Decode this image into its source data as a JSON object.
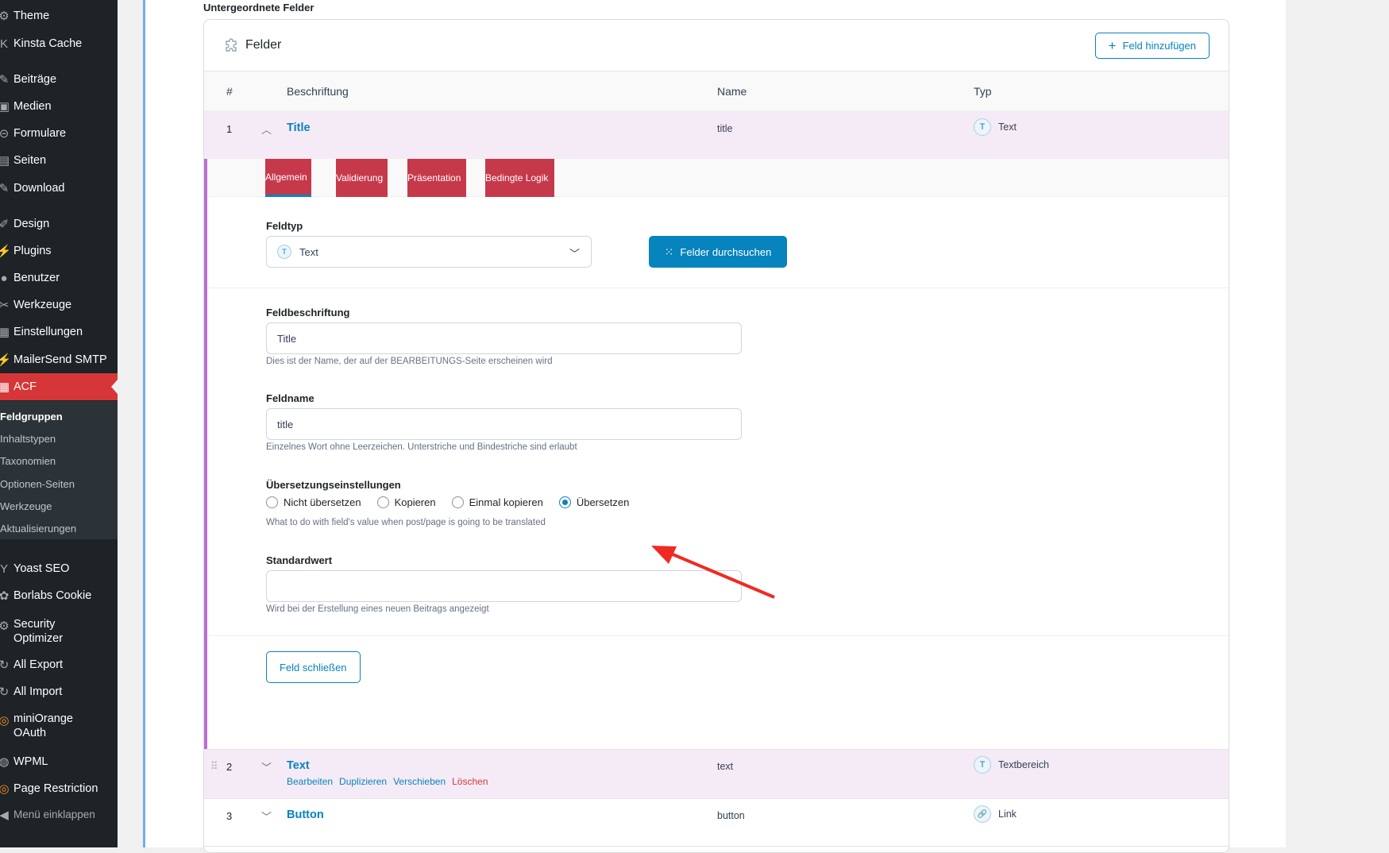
{
  "sidebar": {
    "items": [
      {
        "label": "Theme",
        "icon": "gear-icon",
        "glyph": "⚙"
      },
      {
        "label": "Kinsta Cache",
        "icon": "kinsta-icon",
        "glyph": "K"
      },
      {
        "label": "Beiträge",
        "icon": "pin-icon",
        "glyph": "✎"
      },
      {
        "label": "Medien",
        "icon": "media-icon",
        "glyph": "▣"
      },
      {
        "label": "Formulare",
        "icon": "forms-icon",
        "glyph": "⊝"
      },
      {
        "label": "Seiten",
        "icon": "page-icon",
        "glyph": "▤"
      },
      {
        "label": "Download",
        "icon": "pin-icon",
        "glyph": "✎"
      },
      {
        "label": "Design",
        "icon": "brush-icon",
        "glyph": "✐"
      },
      {
        "label": "Plugins",
        "icon": "plug-icon",
        "glyph": "⚡"
      },
      {
        "label": "Benutzer",
        "icon": "user-icon",
        "glyph": "●"
      },
      {
        "label": "Werkzeuge",
        "icon": "wrench-icon",
        "glyph": "✂"
      },
      {
        "label": "Einstellungen",
        "icon": "settings-icon",
        "glyph": "▦"
      },
      {
        "label": "MailerSend SMTP",
        "icon": "mailersend-icon",
        "glyph": "⚡"
      },
      {
        "label": "ACF",
        "icon": "acf-icon",
        "glyph": "▦"
      }
    ],
    "submenu": [
      "Feldgruppen",
      "Inhaltstypen",
      "Taxonomien",
      "Optionen-Seiten",
      "Werkzeuge",
      "Aktualisierungen"
    ],
    "items_after": [
      {
        "label": "Yoast SEO",
        "icon": "yoast-icon",
        "glyph": "Y"
      },
      {
        "label": "Borlabs Cookie",
        "icon": "cookie-icon",
        "glyph": "✿"
      },
      {
        "label": "Security Optimizer",
        "icon": "lock-icon",
        "glyph": "⚙"
      },
      {
        "label": "All Export",
        "icon": "export-icon",
        "glyph": "↻"
      },
      {
        "label": "All Import",
        "icon": "import-icon",
        "glyph": "↻"
      },
      {
        "label": "miniOrange OAuth",
        "icon": "miniorange-icon",
        "glyph": "◎"
      },
      {
        "label": "WPML",
        "icon": "wpml-icon",
        "glyph": "◍"
      },
      {
        "label": "Page Restriction",
        "icon": "restriction-icon",
        "glyph": "◎"
      },
      {
        "label": "Menü einklappen",
        "icon": "collapse-icon",
        "glyph": "◀"
      }
    ]
  },
  "section_label": "Untergeordnete Felder",
  "box": {
    "title": "Felder",
    "add_button": "Feld hinzufügen"
  },
  "columns": {
    "num": "#",
    "label": "Beschriftung",
    "name": "Name",
    "type": "Typ"
  },
  "rows": [
    {
      "num": "1",
      "label": "Title",
      "name": "title",
      "type": "Text",
      "type_glyph": "T"
    },
    {
      "num": "2",
      "label": "Text",
      "name": "text",
      "type": "Textbereich",
      "type_glyph": "T",
      "actions": [
        "Bearbeiten",
        "Duplizieren",
        "Verschieben",
        "Löschen"
      ]
    },
    {
      "num": "3",
      "label": "Button",
      "name": "button",
      "type": "Link",
      "type_glyph": "🔗"
    }
  ],
  "tabs": [
    "Allgemein",
    "Validierung",
    "Präsentation",
    "Bedingte Logik"
  ],
  "form": {
    "feldtyp_label": "Feldtyp",
    "feldtyp_value": "Text",
    "feldtyp_glyph": "T",
    "browse_button": "Felder durchsuchen",
    "beschriftung_label": "Feldbeschriftung",
    "beschriftung_value": "Title",
    "beschriftung_hint": "Dies ist der Name, der auf der BEARBEITUNGS-Seite erscheinen wird",
    "name_label": "Feldname",
    "name_value": "title",
    "name_hint": "Einzelnes Wort ohne Leerzeichen. Unterstriche und Bindestriche sind erlaubt",
    "translation_label": "Übersetzungseinstellungen",
    "translation_options": [
      "Nicht übersetzen",
      "Kopieren",
      "Einmal kopieren",
      "Übersetzen"
    ],
    "translation_selected": "Übersetzen",
    "translation_hint": "What to do with field's value when post/page is going to be translated",
    "default_label": "Standardwert",
    "default_value": "",
    "default_hint": "Wird bei der Erstellung eines neuen Beitrags angezeigt",
    "close_button": "Feld schließen"
  },
  "colors": {
    "acf_red": "#d63638",
    "tab_red": "#c6394b",
    "accent_blue": "#0783be",
    "arrow_red": "#f02a22",
    "expanded_border": "#b96fd4"
  }
}
